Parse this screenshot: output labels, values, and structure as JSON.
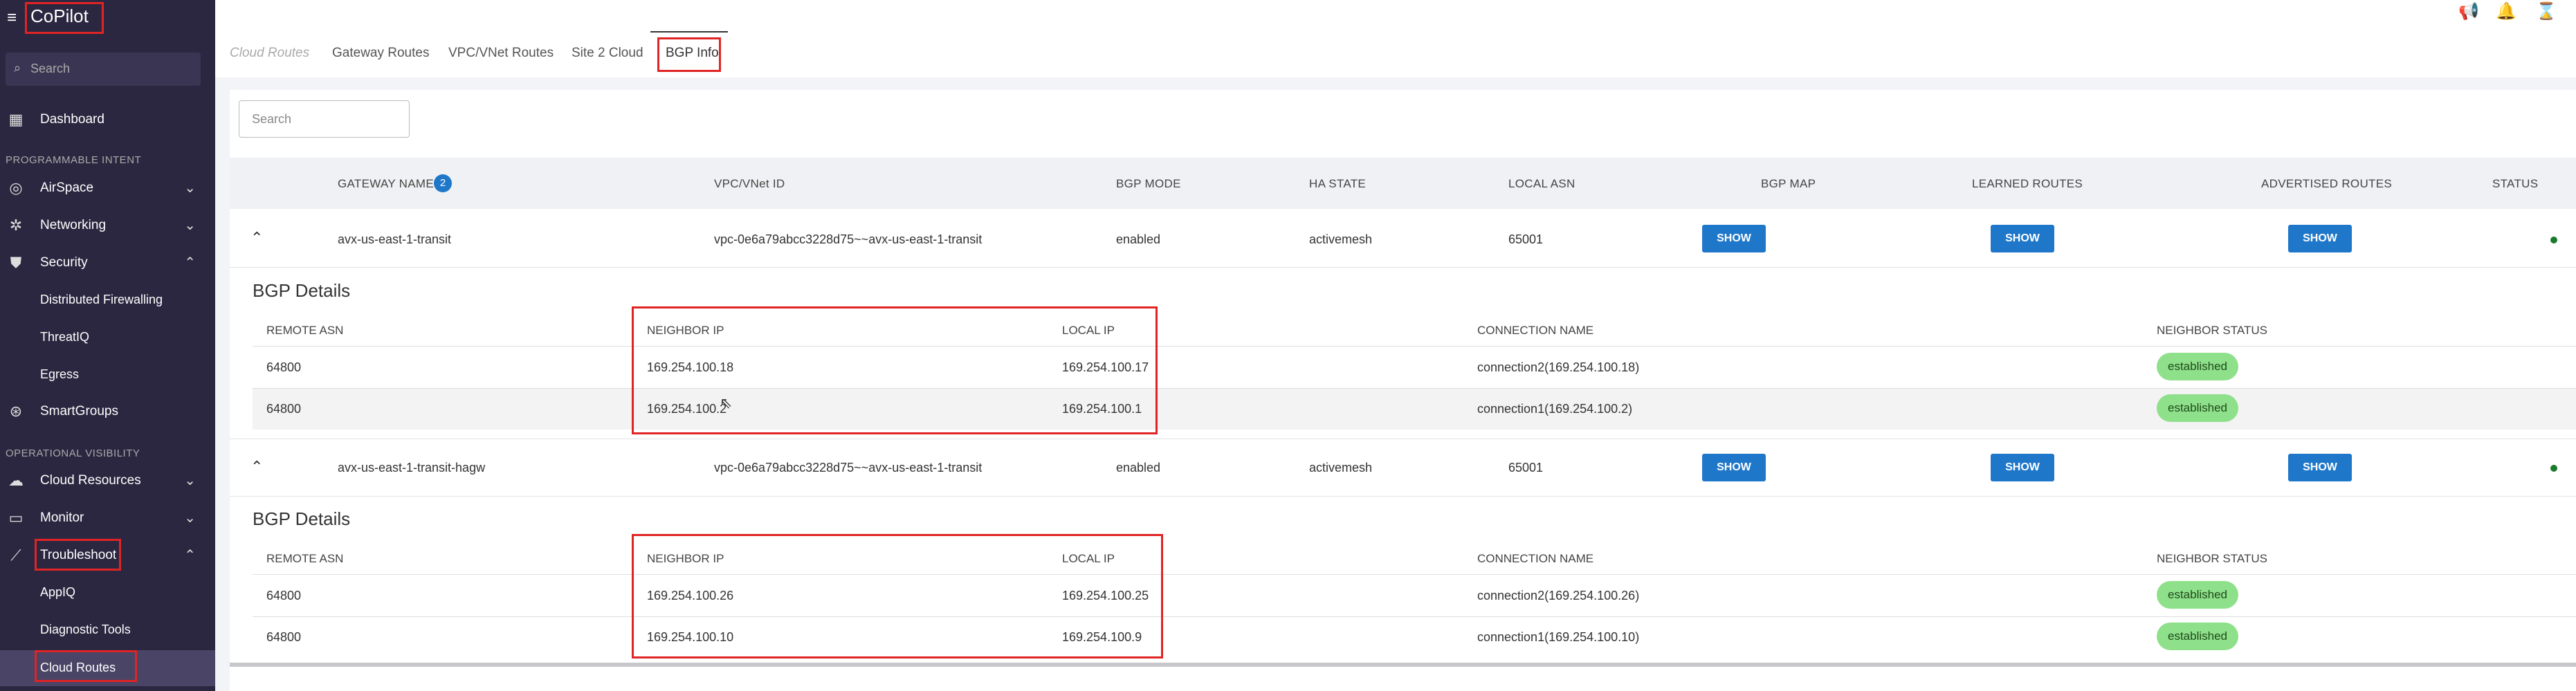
{
  "app": {
    "title": "CoPilot"
  },
  "sidebar": {
    "search_placeholder": "Search",
    "dashboard": "Dashboard",
    "section_programmable": "PROGRAMMABLE INTENT",
    "airspace": "AirSpace",
    "networking": "Networking",
    "security": "Security",
    "security_items": [
      "Distributed Firewalling",
      "ThreatIQ",
      "Egress"
    ],
    "smartgroups": "SmartGroups",
    "section_operational": "OPERATIONAL VISIBILITY",
    "cloud_resources": "Cloud Resources",
    "monitor": "Monitor",
    "troubleshoot": "Troubleshoot",
    "troubleshoot_items": [
      "AppIQ",
      "Diagnostic Tools",
      "Cloud Routes"
    ]
  },
  "tabs": [
    "Cloud Routes",
    "Gateway Routes",
    "VPC/VNet Routes",
    "Site 2 Cloud",
    "BGP Info"
  ],
  "search": {
    "placeholder": "Search"
  },
  "table": {
    "headers": [
      "GATEWAY NAME",
      "VPC/VNet ID",
      "BGP MODE",
      "HA STATE",
      "LOCAL ASN",
      "BGP MAP",
      "LEARNED ROUTES",
      "ADVERTISED ROUTES",
      "STATUS"
    ],
    "gateway_count": "2",
    "show_label": "SHOW",
    "rows": [
      {
        "gateway": "avx-us-east-1-transit",
        "vpc": "vpc-0e6a79abcc3228d75~~avx-us-east-1-transit",
        "mode": "enabled",
        "ha": "activemesh",
        "asn": "65001"
      },
      {
        "gateway": "avx-us-east-1-transit-hagw",
        "vpc": "vpc-0e6a79abcc3228d75~~avx-us-east-1-transit",
        "mode": "enabled",
        "ha": "activemesh",
        "asn": "65001"
      }
    ]
  },
  "details": {
    "title": "BGP Details",
    "headers": [
      "REMOTE ASN",
      "NEIGHBOR IP",
      "LOCAL IP",
      "CONNECTION NAME",
      "NEIGHBOR STATUS"
    ],
    "blocks": [
      [
        {
          "remote_asn": "64800",
          "neighbor_ip": "169.254.100.18",
          "local_ip": "169.254.100.17",
          "conn": "connection2(169.254.100.18)",
          "status": "established"
        },
        {
          "remote_asn": "64800",
          "neighbor_ip": "169.254.100.2",
          "local_ip": "169.254.100.1",
          "conn": "connection1(169.254.100.2)",
          "status": "established"
        }
      ],
      [
        {
          "remote_asn": "64800",
          "neighbor_ip": "169.254.100.26",
          "local_ip": "169.254.100.25",
          "conn": "connection2(169.254.100.26)",
          "status": "established"
        },
        {
          "remote_asn": "64800",
          "neighbor_ip": "169.254.100.10",
          "local_ip": "169.254.100.9",
          "conn": "connection1(169.254.100.10)",
          "status": "established"
        }
      ]
    ]
  },
  "icons": {
    "hamburger": "menu-icon",
    "search": "search-icon",
    "announce": "megaphone-icon",
    "bell": "bell-icon",
    "hourglass": "hourglass-icon"
  },
  "colors": {
    "accent": "#1f77c9",
    "sidebar": "#2b2740",
    "highlight": "#e02424",
    "established": "#8ee08a",
    "status_ok": "#1a7a2b"
  }
}
